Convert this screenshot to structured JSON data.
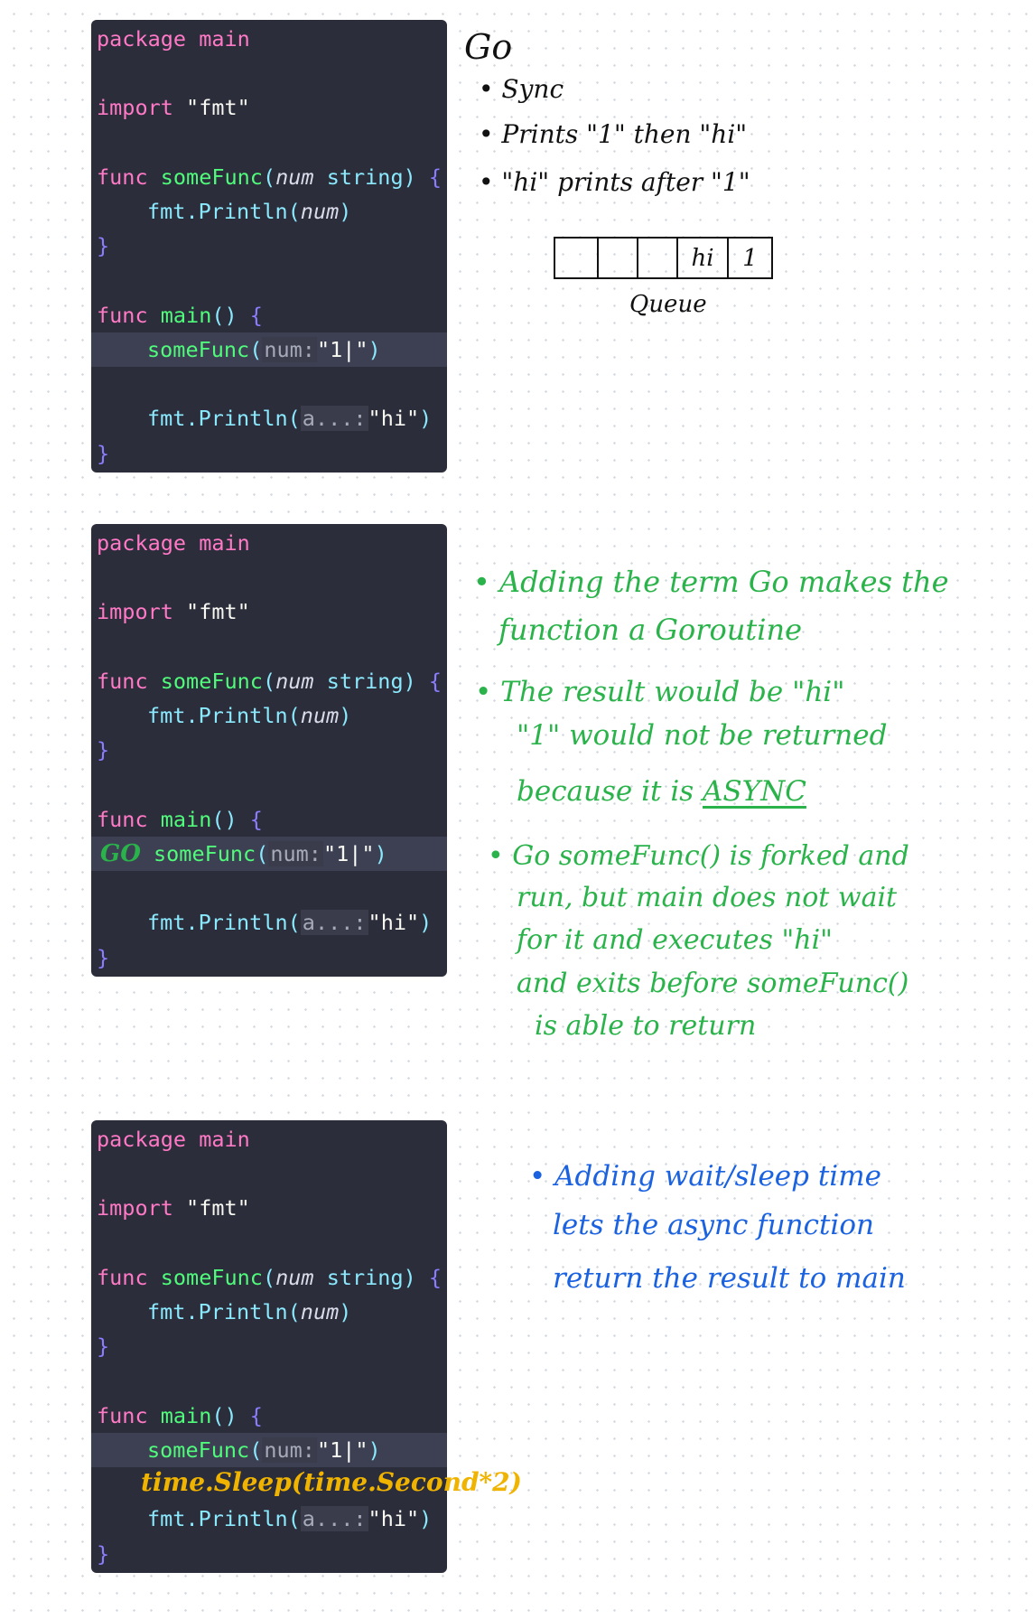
{
  "blocks": [
    {
      "lines": [
        {
          "pkg_kw": "package",
          "pkg_name": "main"
        },
        {
          "import_kw": "import",
          "import_path": "\"fmt\""
        },
        {
          "func_kw": "func",
          "fn_name": "someFunc",
          "param_name": "num",
          "param_type": "string",
          "open": "{"
        },
        {
          "call_obj": "fmt.",
          "call_fn": "Println",
          "arg": "num"
        },
        {
          "close": "}"
        },
        {
          "func_kw": "func",
          "fn_name": "main",
          "sig": "()",
          "open": "{"
        },
        {
          "prefix": "",
          "call_fn": "someFunc",
          "hint": "num:",
          "arg_before_caret": "\"1",
          "arg_after_caret": "\""
        },
        {
          "call_obj": "fmt.",
          "call_fn": "Println",
          "hint": "a...:",
          "arg": "\"hi\""
        },
        {
          "close": "}"
        }
      ]
    },
    {
      "lines": [
        {
          "pkg_kw": "package",
          "pkg_name": "main"
        },
        {
          "import_kw": "import",
          "import_path": "\"fmt\""
        },
        {
          "func_kw": "func",
          "fn_name": "someFunc",
          "param_name": "num",
          "param_type": "string",
          "open": "{"
        },
        {
          "call_obj": "fmt.",
          "call_fn": "Println",
          "arg": "num"
        },
        {
          "close": "}"
        },
        {
          "func_kw": "func",
          "fn_name": "main",
          "sig": "()",
          "open": "{"
        },
        {
          "prefix": "GO",
          "call_fn": "someFunc",
          "hint": "num:",
          "arg_before_caret": "\"1",
          "arg_after_caret": "\""
        },
        {
          "call_obj": "fmt.",
          "call_fn": "Println",
          "hint": "a...:",
          "arg": "\"hi\""
        },
        {
          "close": "}"
        }
      ]
    },
    {
      "lines": [
        {
          "pkg_kw": "package",
          "pkg_name": "main"
        },
        {
          "import_kw": "import",
          "import_path": "\"fmt\""
        },
        {
          "func_kw": "func",
          "fn_name": "someFunc",
          "param_name": "num",
          "param_type": "string",
          "open": "{"
        },
        {
          "call_obj": "fmt.",
          "call_fn": "Println",
          "arg": "num"
        },
        {
          "close": "}"
        },
        {
          "func_kw": "func",
          "fn_name": "main",
          "sig": "()",
          "open": "{"
        },
        {
          "prefix": "",
          "call_fn": "someFunc",
          "hint": "num:",
          "arg_before_caret": "\"1",
          "arg_after_caret": "\""
        },
        {
          "sleep_annotation": "time.Sleep(time.Second*2)"
        },
        {
          "call_obj": "fmt.",
          "call_fn": "Println",
          "hint": "a...:",
          "arg": "\"hi\""
        },
        {
          "close": "}"
        }
      ]
    }
  ],
  "notes": {
    "sync": {
      "title": "Go",
      "bullets": [
        "• Sync",
        "• Prints \"1\" then \"hi\"",
        "• \"hi\" prints after \"1\""
      ],
      "queue_cells": [
        "",
        "",
        "",
        "hi",
        "1"
      ],
      "queue_label": "Queue"
    },
    "goroutine": {
      "b1_l1": "• Adding the term Go makes the",
      "b1_l2": "function a Goroutine",
      "b2_l1": "• The result would be \"hi\"",
      "b2_l2": "\"1\" would not be returned",
      "b2_l3_pre": "because it is ",
      "b2_l3_async": "ASYNC",
      "b3_l1": "• Go someFunc() is forked and",
      "b3_l2": "run, but main does not wait",
      "b3_l3": "for it and executes \"hi\"",
      "b3_l4": "and exits before someFunc()",
      "b3_l5": "is able to return"
    },
    "sleep": {
      "l1": "• Adding wait/sleep time",
      "l2": "lets the async function",
      "l3": "return the result to main"
    }
  },
  "colors": {
    "code_bg": "#2b2d3a",
    "ink_black": "#111111",
    "ink_green": "#2ab34a",
    "ink_blue": "#1a62e0",
    "ink_yellow": "#f0b400"
  }
}
